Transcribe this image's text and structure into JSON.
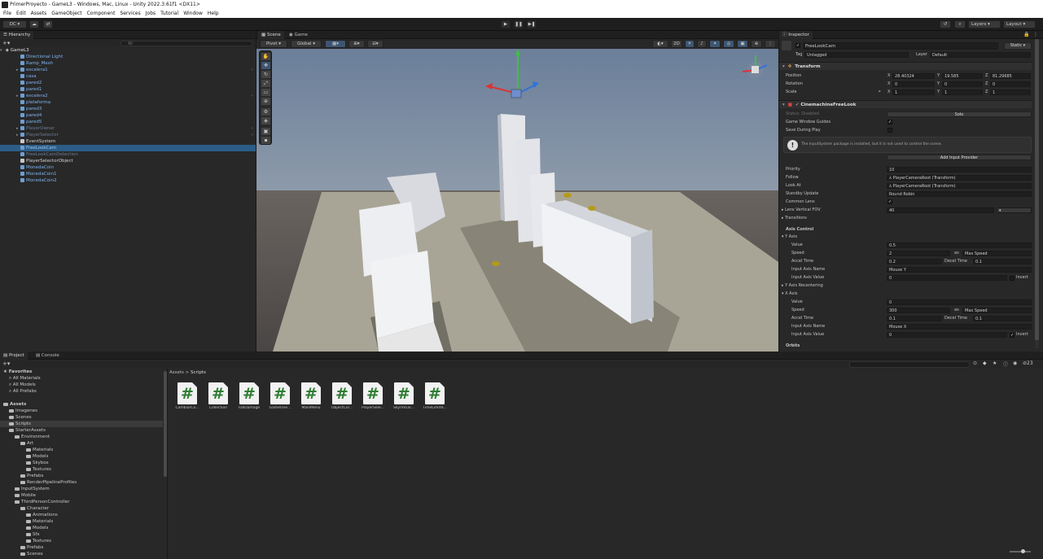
{
  "window": {
    "title": "PrimerProyecto - GameL3 - Windows, Mac, Linux - Unity 2022.3.61f1 <DX11>"
  },
  "menu": [
    "File",
    "Edit",
    "Assets",
    "GameObject",
    "Component",
    "Services",
    "Jobs",
    "Tutorial",
    "Window",
    "Help"
  ],
  "toolbar": {
    "account": "DC ▾",
    "layers": "Layers",
    "layout": "Layout"
  },
  "hierarchy": {
    "tab": "Hierarchy",
    "search_placeholder": "All",
    "scene": "GameL3",
    "items": [
      {
        "label": "Directional Light",
        "style": "blue",
        "arrow": ""
      },
      {
        "label": "Ramp_Mesh",
        "style": "blue",
        "arrow": ""
      },
      {
        "label": "escalera1",
        "style": "blue",
        "arrow": "▸"
      },
      {
        "label": "casa",
        "style": "blue",
        "arrow": ""
      },
      {
        "label": "pared2",
        "style": "blue",
        "arrow": ""
      },
      {
        "label": "pared1",
        "style": "blue",
        "arrow": ""
      },
      {
        "label": "escalera2",
        "style": "blue",
        "arrow": "▸"
      },
      {
        "label": "plataforma",
        "style": "blue",
        "arrow": ""
      },
      {
        "label": "pared3",
        "style": "blue",
        "arrow": ""
      },
      {
        "label": "pared4",
        "style": "blue",
        "arrow": ""
      },
      {
        "label": "pared5",
        "style": "blue",
        "arrow": ""
      },
      {
        "label": "PlayerOwner",
        "style": "dim",
        "arrow": "▸"
      },
      {
        "label": "PlayerSelector",
        "style": "dim",
        "arrow": "▸"
      },
      {
        "label": "EventSystem",
        "style": "white",
        "arrow": ""
      },
      {
        "label": "FreeLookCam",
        "style": "sel",
        "arrow": ""
      },
      {
        "label": "FreeLookCamDetection",
        "style": "dim",
        "arrow": ""
      },
      {
        "label": "PlayerSelectorObject",
        "style": "white",
        "arrow": ""
      },
      {
        "label": "MonedaCoin",
        "style": "blue",
        "arrow": ""
      },
      {
        "label": "MonedaCoin1",
        "style": "blue",
        "arrow": ""
      },
      {
        "label": "MonedaCoin2",
        "style": "blue",
        "arrow": ""
      }
    ]
  },
  "scene_view": {
    "tabs": [
      "Scene",
      "Game"
    ],
    "pivot": "Pivot",
    "global": "Global",
    "gizmo_2d": "2D"
  },
  "inspector": {
    "tab": "Inspector",
    "object_name": "FreeLookCam",
    "static_label": "Static",
    "tag_label": "Tag",
    "tag": "Untagged",
    "layer_label": "Layer",
    "layer": "Default",
    "transform": {
      "title": "Transform",
      "position_label": "Position",
      "rotation_label": "Rotation",
      "scale_label": "Scale",
      "position": [
        "28.40324",
        "19.585",
        "81.29685"
      ],
      "rotation": [
        "0",
        "0",
        "0"
      ],
      "scale": [
        "1",
        "1",
        "1"
      ]
    },
    "cinemachine": {
      "title": "CinemachineFreeLook",
      "status_label": "Status: Disabled",
      "solo": "Solo",
      "game_window_guides": "Game Window Guides",
      "save_during_play": "Save During Play",
      "info": "The InputSystem package is installed, but it is not used to control the scene.",
      "add_input_provider": "Add Input Provider",
      "priority_label": "Priority",
      "priority": "10",
      "follow_label": "Follow",
      "follow": "PlayerCameraRoot (Transform)",
      "lookat_label": "Look At",
      "lookat": "PlayerCameraRoot (Transform)",
      "standby_label": "Standby Update",
      "standby": "Round Robin",
      "common_lens": "Common Lens",
      "fov_label": "Lens Vertical FOV",
      "fov": "40",
      "transitions": "Transitions",
      "axis_control": "Axis Control",
      "y_axis": "Y Axis",
      "y_value": "0.5",
      "y_speed": "2",
      "y_speed_mode": "Max Speed",
      "y_accel": "0.2",
      "y_decel": "0.1",
      "y_input_name": "Mouse Y",
      "y_input_value": "0",
      "y_recentering": "Y Axis Recentering",
      "x_axis": "X Axis",
      "x_value": "0",
      "x_speed": "300",
      "x_speed_mode": "Max Speed",
      "x_accel": "0.1",
      "x_decel": "0.1",
      "x_input_name": "Mouse X",
      "x_input_value": "0",
      "orbits": "Orbits",
      "labels": {
        "value": "Value",
        "speed": "Speed",
        "accel": "Accel Time",
        "decel": "Decel Time",
        "input_name": "Input Axis Name",
        "input_value": "Input Axis Value",
        "invert": "Invert",
        "as": "as"
      }
    }
  },
  "project": {
    "tabs": [
      "Project",
      "Console"
    ],
    "breadcrumb": [
      "Assets",
      "Scripts"
    ],
    "badge": "23",
    "tree": [
      {
        "label": "Favorites",
        "indent": 0,
        "bold": true,
        "icon": "star"
      },
      {
        "label": "All Materials",
        "indent": 1,
        "icon": "search"
      },
      {
        "label": "All Models",
        "indent": 1,
        "icon": "search"
      },
      {
        "label": "All Prefabs",
        "indent": 1,
        "icon": "search"
      },
      {
        "label": "",
        "indent": 0,
        "icon": "none"
      },
      {
        "label": "Assets",
        "indent": 0,
        "bold": true,
        "icon": "folder"
      },
      {
        "label": "Imagenes",
        "indent": 1,
        "icon": "folder"
      },
      {
        "label": "Scenes",
        "indent": 1,
        "icon": "folder"
      },
      {
        "label": "Scripts",
        "indent": 1,
        "icon": "folder",
        "selected": true
      },
      {
        "label": "StarterAssets",
        "indent": 1,
        "icon": "folder"
      },
      {
        "label": "Environment",
        "indent": 2,
        "icon": "folder"
      },
      {
        "label": "Art",
        "indent": 3,
        "icon": "folder"
      },
      {
        "label": "Materials",
        "indent": 4,
        "icon": "folder"
      },
      {
        "label": "Models",
        "indent": 4,
        "icon": "folder"
      },
      {
        "label": "Skybox",
        "indent": 4,
        "icon": "folder"
      },
      {
        "label": "Textures",
        "indent": 4,
        "icon": "folder"
      },
      {
        "label": "Prefabs",
        "indent": 3,
        "icon": "folder"
      },
      {
        "label": "RenderPipelineProfiles",
        "indent": 3,
        "icon": "folder"
      },
      {
        "label": "InputSystem",
        "indent": 2,
        "icon": "folder"
      },
      {
        "label": "Mobile",
        "indent": 2,
        "icon": "folder"
      },
      {
        "label": "ThirdPersonController",
        "indent": 2,
        "icon": "folder"
      },
      {
        "label": "Character",
        "indent": 3,
        "icon": "folder"
      },
      {
        "label": "Animations",
        "indent": 4,
        "icon": "folder"
      },
      {
        "label": "Materials",
        "indent": 4,
        "icon": "folder"
      },
      {
        "label": "Models",
        "indent": 4,
        "icon": "folder"
      },
      {
        "label": "Sfx",
        "indent": 4,
        "icon": "folder"
      },
      {
        "label": "Textures",
        "indent": 4,
        "icon": "folder"
      },
      {
        "label": "Prefabs",
        "indent": 3,
        "icon": "folder"
      },
      {
        "label": "Scenes",
        "indent": 3,
        "icon": "folder"
      }
    ],
    "assets": [
      "CambiarCo...",
      "Collection",
      "FallDamage",
      "GameOve...",
      "MainMenu",
      "ObjectCol...",
      "PlayerSele...",
      "SkyrimLik...",
      "TimeLimitR..."
    ]
  }
}
